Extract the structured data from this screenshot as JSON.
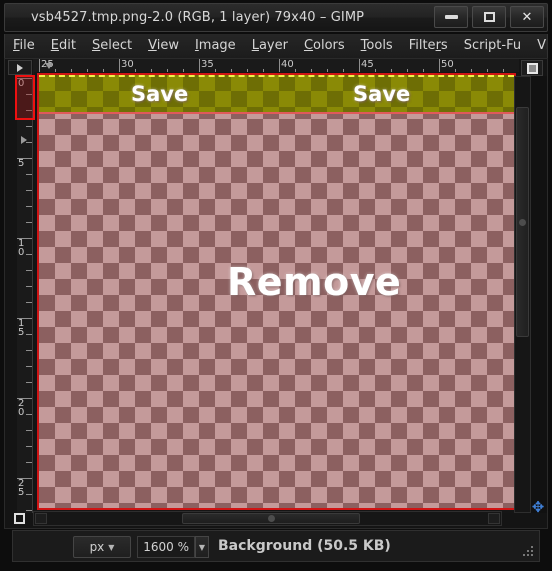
{
  "window": {
    "title": "vsb4527.tmp.png-2.0 (RGB, 1 layer) 79x40 – GIMP",
    "buttons": {
      "minimize": "minimize-icon",
      "maximize": "maximize-icon",
      "close": "close-icon"
    }
  },
  "menubar": {
    "items": [
      {
        "label": "File",
        "mnemonic": "F"
      },
      {
        "label": "Edit",
        "mnemonic": "E"
      },
      {
        "label": "Select",
        "mnemonic": "S"
      },
      {
        "label": "View",
        "mnemonic": "V"
      },
      {
        "label": "Image",
        "mnemonic": "I"
      },
      {
        "label": "Layer",
        "mnemonic": "L"
      },
      {
        "label": "Colors",
        "mnemonic": "C"
      },
      {
        "label": "Tools",
        "mnemonic": "T"
      },
      {
        "label": "Filters",
        "mnemonic": "r"
      },
      {
        "label": "Script-Fu",
        "mnemonic": ""
      },
      {
        "label": "Video",
        "mnemonic": ""
      }
    ]
  },
  "rulers": {
    "unit": "px",
    "horizontal": {
      "labels": [
        "25",
        "30",
        "35",
        "40",
        "45",
        "50"
      ],
      "start": 25,
      "step": 5,
      "minor_per_major": 5
    },
    "vertical": {
      "labels": [
        "0",
        "5",
        "10",
        "15",
        "20",
        "25"
      ],
      "start": 0,
      "step": 5,
      "minor_per_major": 5
    },
    "origin_highlight_color": "#ee1111"
  },
  "canvas": {
    "selection_border_color": "#f2f24a",
    "layer_border_color": "#d01414",
    "checker_olive_light": "#8a8a06",
    "checker_olive_dark": "#6e6e05",
    "checker_pink_light": "#c49a9a",
    "checker_pink_dark": "#8c6060",
    "labels": [
      {
        "text": "Save",
        "name": "canvas-label-save-left"
      },
      {
        "text": "Save",
        "name": "canvas-label-save-right"
      },
      {
        "text": "Remove",
        "name": "canvas-label-remove"
      }
    ]
  },
  "statusbar": {
    "unit_value": "px",
    "zoom_value": "1600 %",
    "message": "Background (50.5 KB)"
  },
  "icons": {
    "menu_corner": "triangle-right-icon",
    "quickmask_top": "quick-mask-icon",
    "quickmask_bottom": "quick-mask-toggle-icon",
    "navigate": "move-cross-icon",
    "dropdown_caret": "chevron-down-icon"
  }
}
